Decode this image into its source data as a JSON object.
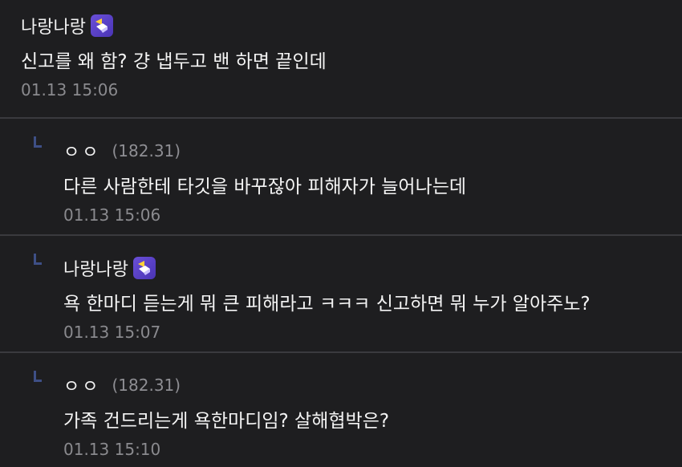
{
  "comments": [
    {
      "author": "나랑나랑",
      "ip": "",
      "text": "신고를 왜 함? 걍 냅두고 밴 하면 끝인데",
      "time": "01.13 15:06",
      "badge": "gallery-manager-badge-icon",
      "is_reply": false
    },
    {
      "author": "ㅇㅇ",
      "ip": "(182.31)",
      "text": "다른 사람한테 타깃을 바꾸잖아 피해자가 늘어나는데",
      "time": "01.13 15:06",
      "is_reply": true
    },
    {
      "author": "나랑나랑",
      "ip": "",
      "text": "욕 한마디 듣는게 뭐 큰 피해라고 ㅋㅋㅋ 신고하면 뭐 누가 알아주노?",
      "time": "01.13 15:07",
      "badge": "gallery-manager-badge-icon",
      "is_reply": true
    },
    {
      "author": "ㅇㅇ",
      "ip": "(182.31)",
      "text": "가족 건드리는게 욕한마디임? 살해협박은?",
      "time": "01.13 15:10",
      "is_reply": true
    }
  ],
  "colors": {
    "background": "#1e1e20",
    "divider": "#3a3a3e",
    "reply_marker": "#3e4f86",
    "badge": "#5a40c8",
    "meta_text": "#8a8a8e"
  }
}
